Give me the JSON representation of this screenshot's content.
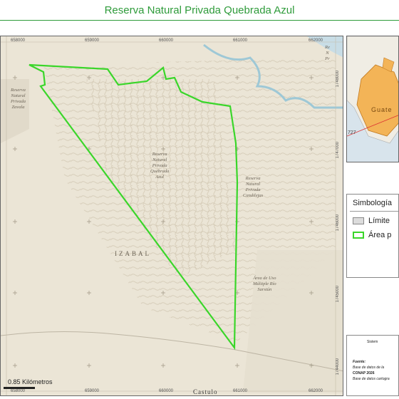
{
  "title": "Reserva Natural Privada Quebrada Azul",
  "map": {
    "x_ticks": [
      "658000",
      "659000",
      "660000",
      "661000",
      "662000"
    ],
    "y_ticks": [
      "1748000",
      "1747000",
      "1746000",
      "1745000",
      "1744000"
    ],
    "labels": {
      "zavala": "Reserva\nNatural\nPrivada\nZavala",
      "quebrada_azul": "Reserva\nNatural\nPrivada\nQuebrada\nAzul",
      "candilejas": "Reserva\nNatural\nPrivada\nCandilejas",
      "sarstun": "Área de Uso\nMúltiple Río\nSarstún",
      "right_edge": "Re\nN\nPr"
    },
    "department": "IZABAL",
    "town": "Castulo",
    "scale": "0.85 Kilómetros",
    "polygon_color": "#3ad62a"
  },
  "inset": {
    "label": "Guate",
    "road": "727"
  },
  "legend": {
    "title": "Simbología",
    "items": [
      {
        "label": "Límite",
        "fill": "#dcdcdc",
        "stroke": "#888888"
      },
      {
        "label": "Área p",
        "fill": "#ffffff",
        "stroke": "#3ad62a"
      }
    ]
  },
  "source": {
    "header": "Sistem",
    "label": "Fuente:",
    "line1": "Base de datos de la",
    "line2": "CONAP 2026",
    "line3": "Base de datos cartogra"
  }
}
